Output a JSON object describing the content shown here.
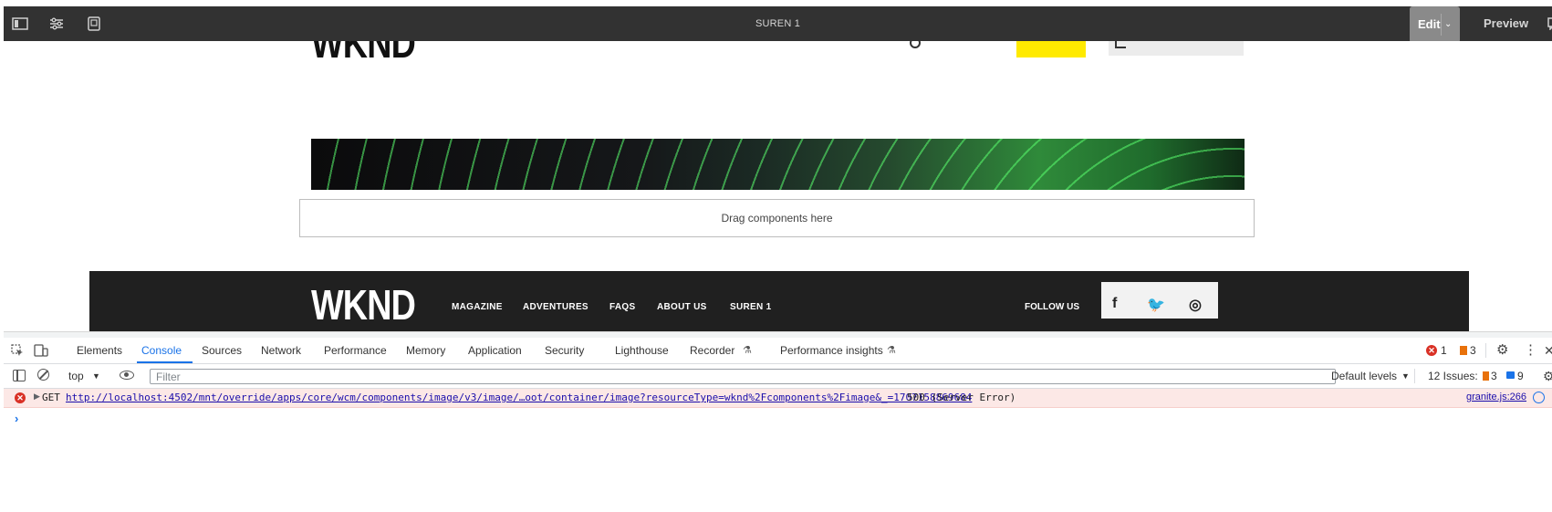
{
  "editor_bar": {
    "page_title": "SUREN 1",
    "edit_label": "Edit",
    "preview_label": "Preview"
  },
  "page": {
    "logo_text": "WKND",
    "drop_zone_text": "Drag components here",
    "footer": {
      "logo_text": "WKND",
      "links": [
        "MAGAZINE",
        "ADVENTURES",
        "FAQS",
        "ABOUT US",
        "SUREN 1"
      ],
      "follow_label": "FOLLOW US",
      "social": [
        "f",
        "🐦",
        "◎"
      ]
    }
  },
  "devtools": {
    "tabs": [
      "Elements",
      "Console",
      "Sources",
      "Network",
      "Performance",
      "Memory",
      "Application",
      "Security",
      "Lighthouse",
      "Recorder",
      "Performance insights"
    ],
    "active_tab": "Console",
    "error_count": "1",
    "warning_count": "3",
    "toolbar": {
      "context": "top",
      "filter_placeholder": "Filter",
      "levels": "Default levels",
      "issues_label": "12 Issues:",
      "issues_warning": "3",
      "issues_info": "9"
    },
    "console": {
      "method": "GET",
      "url": "http://localhost:4502/mnt/override/apps/core/wcm/components/image/v3/image/…oot/container/image?resourceType=wknd%2Fcomponents%2Fimage&_=1707158869684",
      "status": "500 (Server Error)",
      "source": "granite.js:266"
    }
  },
  "colors": {
    "editor_bar": "#323232",
    "accent": "#1a73e8",
    "error": "#d93025",
    "warning": "#e8710a",
    "yellow": "#ffea00"
  }
}
